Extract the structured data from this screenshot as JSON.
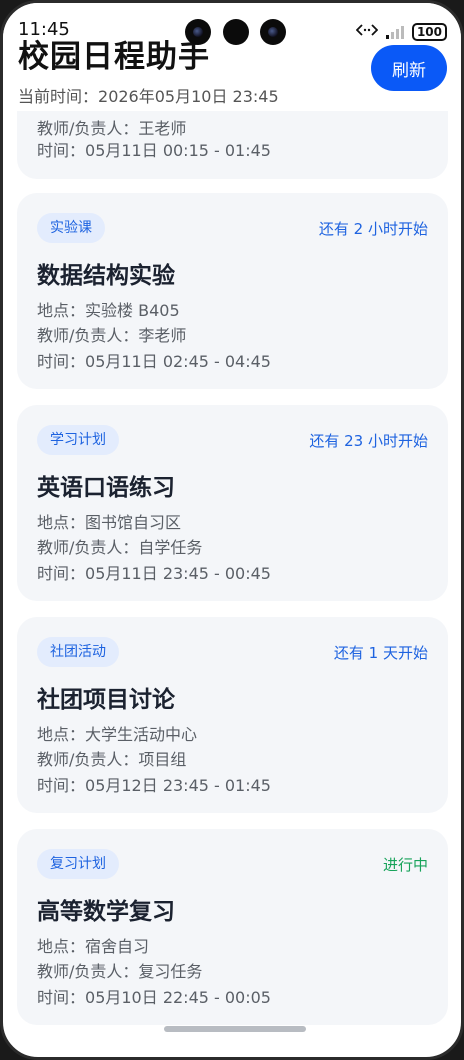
{
  "status_bar": {
    "time": "11:45",
    "battery": "100"
  },
  "header": {
    "title": "校园日程助手",
    "current_time_label": "当前时间：",
    "current_time": "2026年05月10日 23:45",
    "refresh_label": "刷新"
  },
  "labels": {
    "location": "地点：",
    "teacher": "教师/负责人：",
    "time": "时间："
  },
  "partial_card": {
    "teacher": "王老师",
    "time": "05月11日 00:15 - 01:45"
  },
  "cards": [
    {
      "tag": "实验课",
      "status": "还有 2 小时开始",
      "title": "数据结构实验",
      "location": "实验楼 B405",
      "teacher": "李老师",
      "time": "05月11日 02:45 - 04:45"
    },
    {
      "tag": "学习计划",
      "status": "还有 23 小时开始",
      "title": "英语口语练习",
      "location": "图书馆自习区",
      "teacher": "自学任务",
      "time": "05月11日 23:45 - 00:45"
    },
    {
      "tag": "社团活动",
      "status": "还有 1 天开始",
      "title": "社团项目讨论",
      "location": "大学生活动中心",
      "teacher": "项目组",
      "time": "05月12日 23:45 - 01:45"
    },
    {
      "tag": "复习计划",
      "status": "进行中",
      "title": "高等数学复习",
      "location": "宿舍自习",
      "teacher": "复习任务",
      "time": "05月10日 22:45 - 00:05"
    }
  ],
  "colors": {
    "accent": "#0a59f7",
    "tag_bg": "#e3ecfd",
    "tag_text": "#1e63e0",
    "ongoing": "#17a35a",
    "card_bg": "#f4f6f9"
  }
}
